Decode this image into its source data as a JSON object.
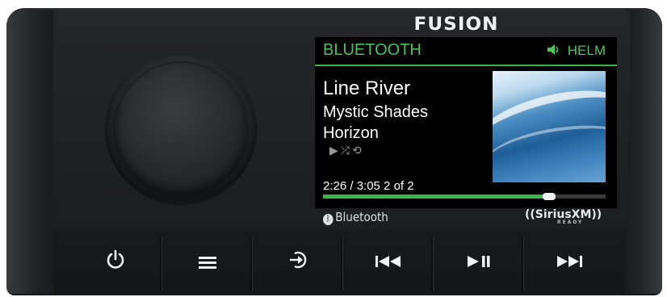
{
  "brand": {
    "logo_text": "FUSION"
  },
  "screen": {
    "source_label": "BLUETOOTH",
    "zone_icon": "speaker-icon",
    "zone_label": "HELM",
    "song_title": "Line River",
    "artist": "Mystic Shades",
    "album": "Horizon",
    "mode_icons": [
      "play-icon",
      "shuffle-icon",
      "repeat-icon"
    ],
    "mode_glyphs": "▶⤮⟲",
    "time_text": "2:26 / 3:05 2 of 2",
    "progress_fraction": 0.8,
    "accent_color": "#39b54a"
  },
  "badges": {
    "bluetooth_text": "Bluetooth",
    "siriusxm_text": "((SiriusXM))",
    "siriusxm_subtext": "READY"
  },
  "buttons": [
    {
      "name": "power-button",
      "icon": "power-icon",
      "glyph": "⏻"
    },
    {
      "name": "menu-button",
      "icon": "menu-icon",
      "glyph": ""
    },
    {
      "name": "source-button",
      "icon": "source-input-icon",
      "glyph": "⎆"
    },
    {
      "name": "previous-track-button",
      "icon": "previous-track-icon",
      "glyph": "⏮"
    },
    {
      "name": "play-pause-button",
      "icon": "play-pause-icon",
      "glyph": "⏯"
    },
    {
      "name": "next-track-button",
      "icon": "next-track-icon",
      "glyph": "⏭"
    }
  ]
}
